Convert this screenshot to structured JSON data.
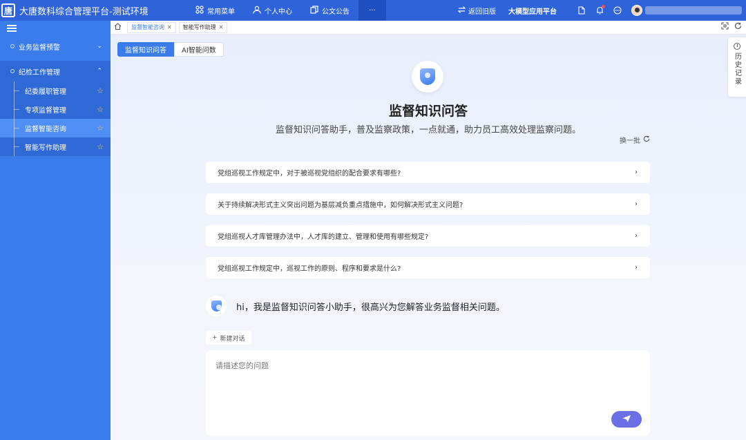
{
  "header": {
    "logo_glyph": "唐",
    "title": "大唐数科综合管理平台-测试环境",
    "nav": [
      {
        "label": "常用菜单",
        "icon": "grid-icon"
      },
      {
        "label": "个人中心",
        "icon": "user-icon"
      },
      {
        "label": "公文公告",
        "icon": "copy-icon"
      }
    ],
    "more_label": "···",
    "return_label": "返回旧版",
    "model_label": "大模型应用平台"
  },
  "sidebar": {
    "groups": [
      {
        "label": "业务监督预警"
      },
      {
        "label": "纪检工作管理"
      }
    ],
    "items": [
      {
        "label": "纪委履职管理"
      },
      {
        "label": "专项监督管理"
      },
      {
        "label": "监督智能咨询"
      },
      {
        "label": "智能写作助理"
      }
    ]
  },
  "tabs": [
    {
      "label": "监督智能咨询"
    },
    {
      "label": "智能写作助理"
    }
  ],
  "modes": {
    "active": "监督知识问答",
    "other": "AI智能问数"
  },
  "history": {
    "label": "历史记录"
  },
  "hero": {
    "title": "监督知识问答",
    "subtitle": "监督知识问答助手，普及监察政策，一点就通，助力员工高效处理监察问题。",
    "refresh_label": "换一批"
  },
  "questions": [
    "党组巡视工作规定中，对于被巡视党组织的配合要求有哪些?",
    "关于持续解决形式主义突出问题为基层减负重点措施中，如何解决形式主义问题?",
    "党组巡视人才库管理办法中，人才库的建立、管理和使用有哪些规定?",
    "党组巡视工作规定中，巡视工作的原则、程序和要求是什么?"
  ],
  "greeting": "hi，我是监督知识问答小助手，很高兴为您解答业务监督相关问题。",
  "new_chat_label": "新建对话",
  "composer": {
    "placeholder": "请描述您的问题",
    "value": ""
  },
  "colors": {
    "primary": "#3b7cec",
    "topbar": "#2f63d9",
    "send": "#6b6fe6"
  }
}
